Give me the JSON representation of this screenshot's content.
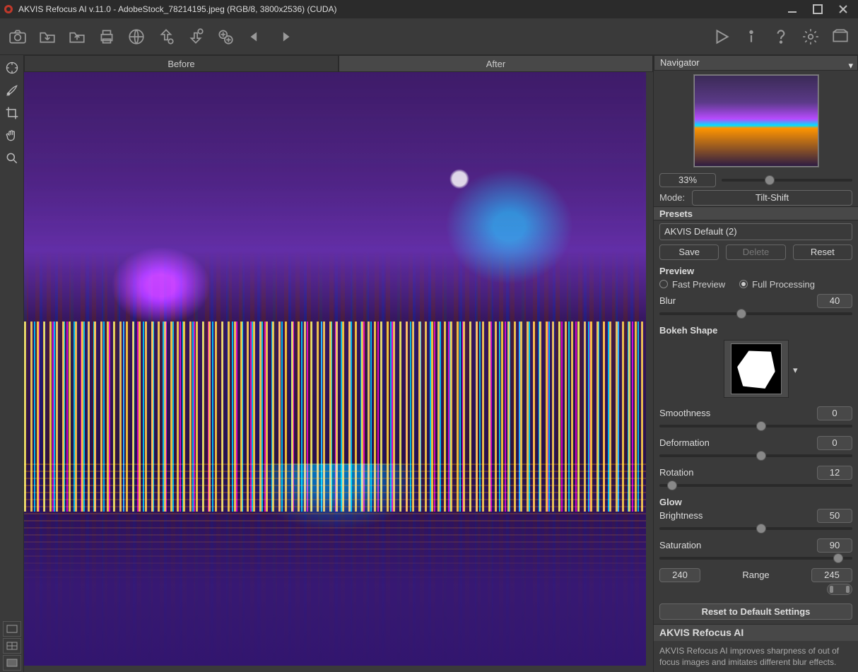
{
  "window": {
    "title": "AKVIS Refocus AI v.11.0 - AdobeStock_78214195.jpeg (RGB/8, 3800x2536) (CUDA)"
  },
  "tabs": {
    "before": "Before",
    "after": "After"
  },
  "navigator": {
    "label": "Navigator",
    "zoom": "33%"
  },
  "mode": {
    "label": "Mode:",
    "value": "Tilt-Shift"
  },
  "presets": {
    "label": "Presets",
    "current": "AKVIS Default (2)",
    "save": "Save",
    "delete": "Delete",
    "reset": "Reset"
  },
  "preview": {
    "label": "Preview",
    "fast": "Fast Preview",
    "full": "Full Processing",
    "selected": "full"
  },
  "params": {
    "blur": {
      "label": "Blur",
      "value": "40",
      "pos": 40
    },
    "bokeh_label": "Bokeh Shape",
    "smoothness": {
      "label": "Smoothness",
      "value": "0",
      "pos": 50
    },
    "deformation": {
      "label": "Deformation",
      "value": "0",
      "pos": 50
    },
    "rotation": {
      "label": "Rotation",
      "value": "12",
      "pos": 4
    },
    "glow_label": "Glow",
    "brightness": {
      "label": "Brightness",
      "value": "50",
      "pos": 50
    },
    "saturation": {
      "label": "Saturation",
      "value": "90",
      "pos": 90
    },
    "range": {
      "label": "Range",
      "low": "240",
      "high": "245"
    }
  },
  "reset_defaults": "Reset to Default Settings",
  "info": {
    "title": "AKVIS Refocus AI",
    "body": "AKVIS Refocus AI improves sharpness of out of focus images and imitates different blur effects."
  }
}
